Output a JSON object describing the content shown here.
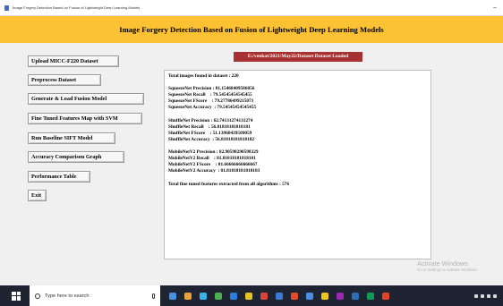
{
  "window": {
    "title": "Image Forgery Detection Based on Fusion of Lightweight Deep Learning Models",
    "minimize_label": "–"
  },
  "banner": {
    "title": "Image Forgery Detection Based on Fusion of Lightweight Deep Learning Models"
  },
  "buttons": {
    "upload": "Upload MICC-F220 Dataset",
    "preprocess": "Preprocess Dataset",
    "generate": "Generate & Load Fusion Model",
    "finetune": "Fine Tuned Features Map with SVM",
    "baseline": "Run Baseline SIFT Model",
    "accuracy": "Accuracy Comparison Graph",
    "performance": "Performance Table",
    "exit": "Exit"
  },
  "status": {
    "path": "E:/venkat/2021/May22/Dataset Dataset Loaded"
  },
  "output": {
    "lines": [
      "Total images found in dataset : 220",
      "",
      "SqueezeNet Precision : 81.15468409586056",
      "SqueezeNet Recall    : 79.54545454545455",
      "SqueezeNet FScore    : 79.27786499215071",
      "SqueezeNet Accuracy  : 79.54545454545455",
      "",
      "ShuffleNet Precision : 62.74131274131274",
      "ShuffleNet Recall    : 56.81818181818181",
      "ShuffleNet FScore    : 51.13968439509059",
      "ShuffleNet Accuracy  : 56.81818181818182",
      "",
      "MobileNetV2 Precision : 82.90598290598329",
      "MobileNetV2 Recall    : 81.81818181818181",
      "MobileNetV2 FScore    : 81.66666666666667",
      "MobileNetV2 Accuracy  : 81.81818181818183",
      "",
      "Total fine tuned features extracted from all algorithms : 576"
    ]
  },
  "watermark": {
    "title": "Activate Windows",
    "subtitle": "Go to Settings to activate Windows."
  },
  "taskbar": {
    "search_placeholder": "Type here to search",
    "icon_colors": [
      "#4a90e2",
      "#e8a33c",
      "#3cb4e6",
      "#4caf50",
      "#2f7de1",
      "#e6c229",
      "#d9453b",
      "#3a7bd5",
      "#e34c26",
      "#4a90e2",
      "#f0c419",
      "#9c27b0",
      "#2c6fb7",
      "#0f9d58",
      "#e24329"
    ]
  }
}
